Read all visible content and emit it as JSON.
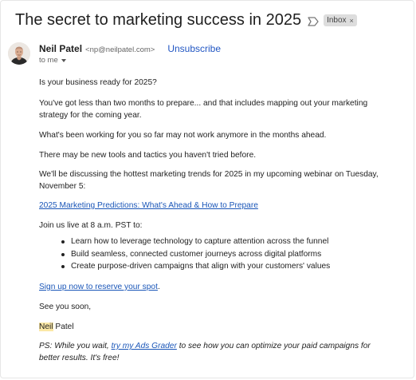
{
  "email": {
    "subject": "The secret to marketing success in 2025",
    "label_chip": "Inbox",
    "label_chip_close": "×",
    "sender": {
      "name": "Neil Patel",
      "email": "<np@neilpatel.com>",
      "unsubscribe": "Unsubscribe",
      "to": "to me"
    },
    "body": {
      "p1": "Is your business ready for 2025?",
      "p2": "You've got less than two months to prepare... and that includes mapping out your marketing strategy for the coming year.",
      "p3": "What's been working for you so far may not work anymore in the months ahead.",
      "p4": "There may be new tools and tactics you haven't tried before.",
      "p5": "We'll be discussing the hottest marketing trends for 2025 in my upcoming webinar on Tuesday, November 5:",
      "webinar_link": "2025 Marketing Predictions: What's Ahead & How to Prepare",
      "p6": "Join us live at 8 a.m. PST to:",
      "bullets": [
        "Learn how to leverage technology to capture attention across the funnel",
        "Build seamless, connected customer journeys across digital platforms",
        "Create purpose-driven campaigns that align with your customers' values"
      ],
      "signup_link": "Sign up now to reserve your spot",
      "signup_period": ".",
      "closing": "See you soon,",
      "signature_first": "Neil",
      "signature_last": " Patel",
      "ps_before": "PS: While you wait, ",
      "ps_link": "try my Ads Grader",
      "ps_after": " to see how you can optimize your paid campaigns for better results. It's free!"
    }
  },
  "colors": {
    "link": "#1a56b8",
    "unsubscribe": "#2156c3",
    "chip_bg": "#dddddd",
    "highlight": "#fbe8a6"
  },
  "icons": {
    "important": "importance-marker-icon",
    "avatar": "sender-avatar",
    "caret": "chevron-down-icon"
  }
}
